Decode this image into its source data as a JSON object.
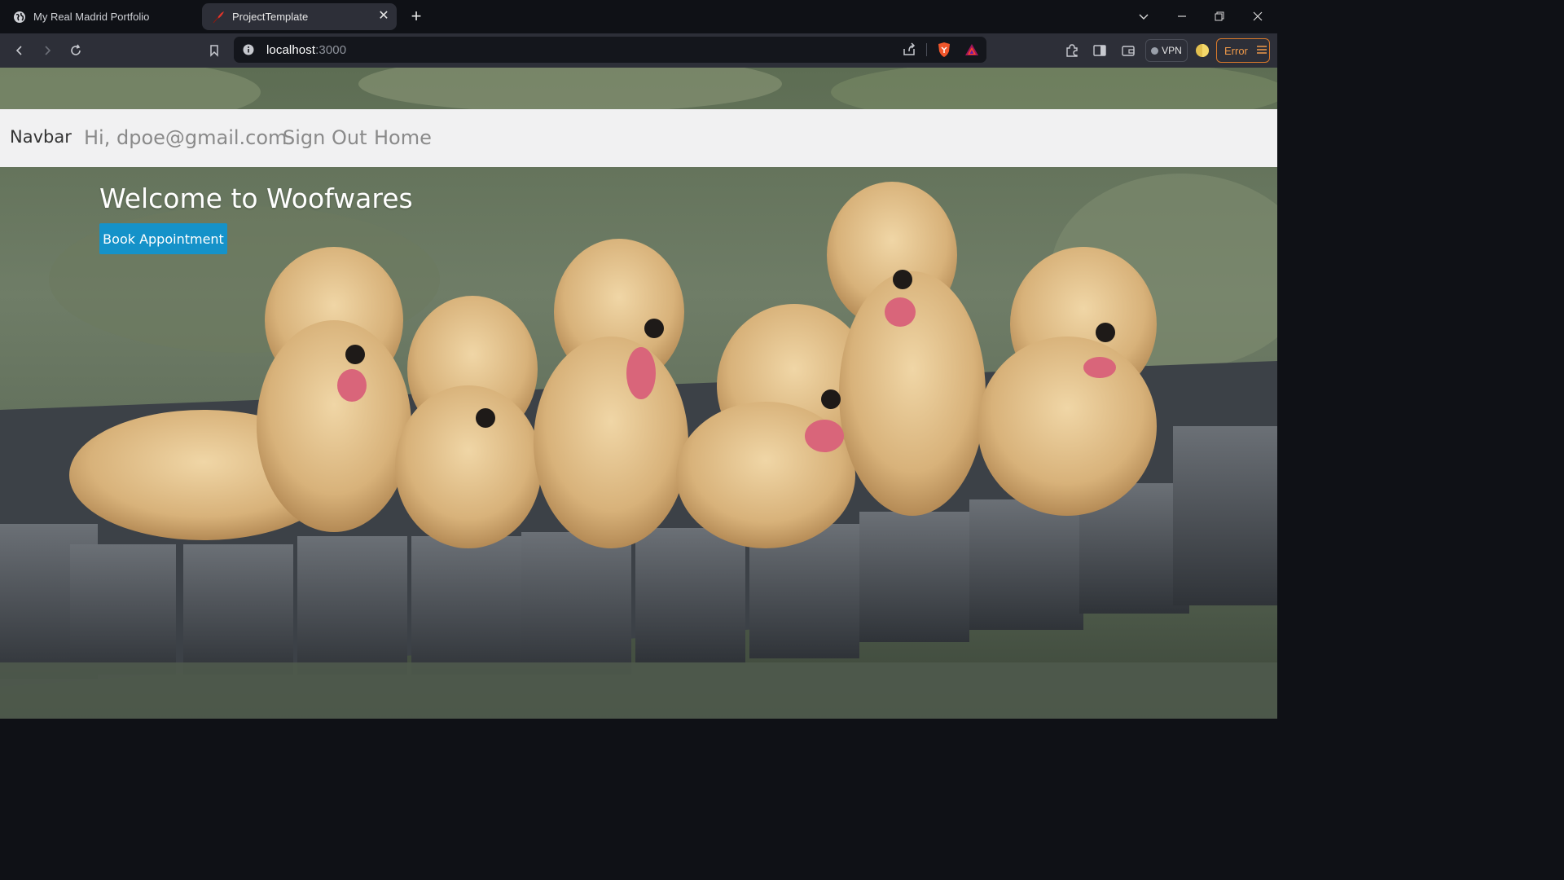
{
  "browser": {
    "tabs": [
      {
        "title": "My Real Madrid Portfolio",
        "icon": "globe-icon",
        "active": false
      },
      {
        "title": "ProjectTemplate",
        "icon": "feather-icon",
        "active": true
      }
    ],
    "address": {
      "host": "localhost",
      "port": ":3000"
    },
    "vpn_label": "VPN",
    "error_label": "Error"
  },
  "page": {
    "navbar": {
      "brand": "Navbar",
      "links": [
        "Hi, dpoe@gmail.com",
        "Sign Out",
        "Home"
      ]
    },
    "hero": {
      "title": "Welcome to Woofwares",
      "button": "Book Appointment"
    }
  },
  "colors": {
    "chrome_dark": "#0f1116",
    "toolbar": "#2d2f38",
    "navbar_bg": "#f1f1f2",
    "button_blue": "#1592c9",
    "error_orange": "#d9792b"
  }
}
